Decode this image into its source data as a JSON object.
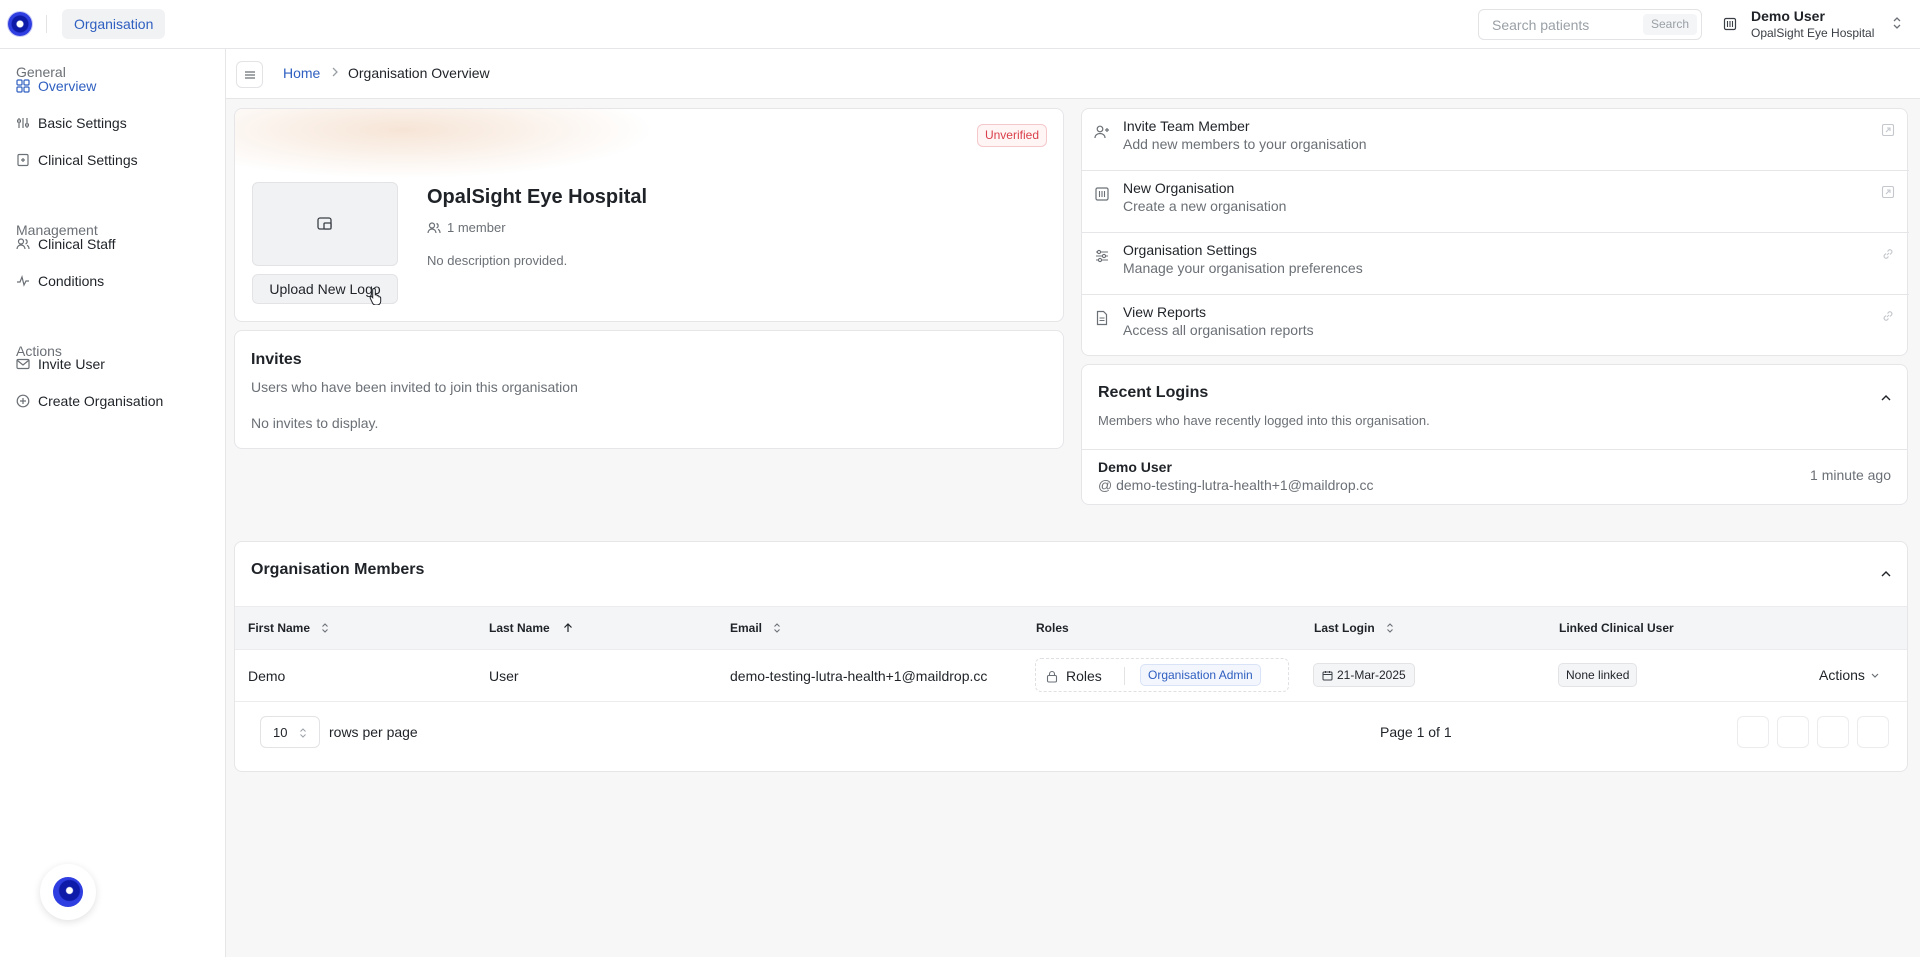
{
  "topbar": {
    "org_chip": "Organisation",
    "search": {
      "placeholder": "Search patients",
      "button": "Search"
    },
    "user": {
      "name": "Demo User",
      "org": "OpalSight Eye Hospital"
    }
  },
  "sidebar": {
    "groups": [
      {
        "label": "General",
        "items": [
          {
            "label": "Overview",
            "active": true
          },
          {
            "label": "Basic Settings"
          },
          {
            "label": "Clinical Settings"
          }
        ]
      },
      {
        "label": "Management",
        "items": [
          {
            "label": "Clinical Staff"
          },
          {
            "label": "Conditions"
          }
        ]
      },
      {
        "label": "Actions",
        "items": [
          {
            "label": "Invite User"
          },
          {
            "label": "Create Organisation"
          }
        ]
      }
    ]
  },
  "breadcrumb": {
    "home": "Home",
    "current": "Organisation Overview"
  },
  "org_card": {
    "status": "Unverified",
    "name": "OpalSight Eye Hospital",
    "members": "1 member",
    "description": "No description provided.",
    "upload_label": "Upload New Logo"
  },
  "invites": {
    "title": "Invites",
    "subtitle": "Users who have been invited to join this organisation",
    "empty": "No invites to display."
  },
  "quick_actions": [
    {
      "title": "Invite Team Member",
      "desc": "Add new members to your organisation"
    },
    {
      "title": "New Organisation",
      "desc": "Create a new organisation"
    },
    {
      "title": "Organisation Settings",
      "desc": "Manage your organisation preferences"
    },
    {
      "title": "View Reports",
      "desc": "Access all organisation reports"
    }
  ],
  "recent_logins": {
    "title": "Recent Logins",
    "subtitle": "Members who have recently logged into this organisation.",
    "rows": [
      {
        "name": "Demo User",
        "email": "@ demo-testing-lutra-health+1@maildrop.cc",
        "time": "1 minute ago"
      }
    ]
  },
  "members": {
    "title": "Organisation Members",
    "columns": [
      "First Name",
      "Last Name",
      "Email",
      "Roles",
      "Last Login",
      "Linked Clinical User"
    ],
    "rows": [
      {
        "first": "Demo",
        "last": "User",
        "email": "demo-testing-lutra-health+1@maildrop.cc",
        "roles_label": "Roles",
        "role": "Organisation Admin",
        "last_login": "21-Mar-2025",
        "linked": "None linked",
        "actions": "Actions"
      }
    ],
    "rows_per_page": "10",
    "rows_per_page_label": "rows per page",
    "page_text": "Page 1 of 1"
  },
  "colors": {
    "accent": "#2f5fc0",
    "danger": "#d9404b",
    "brand": "#1f2bd1"
  }
}
